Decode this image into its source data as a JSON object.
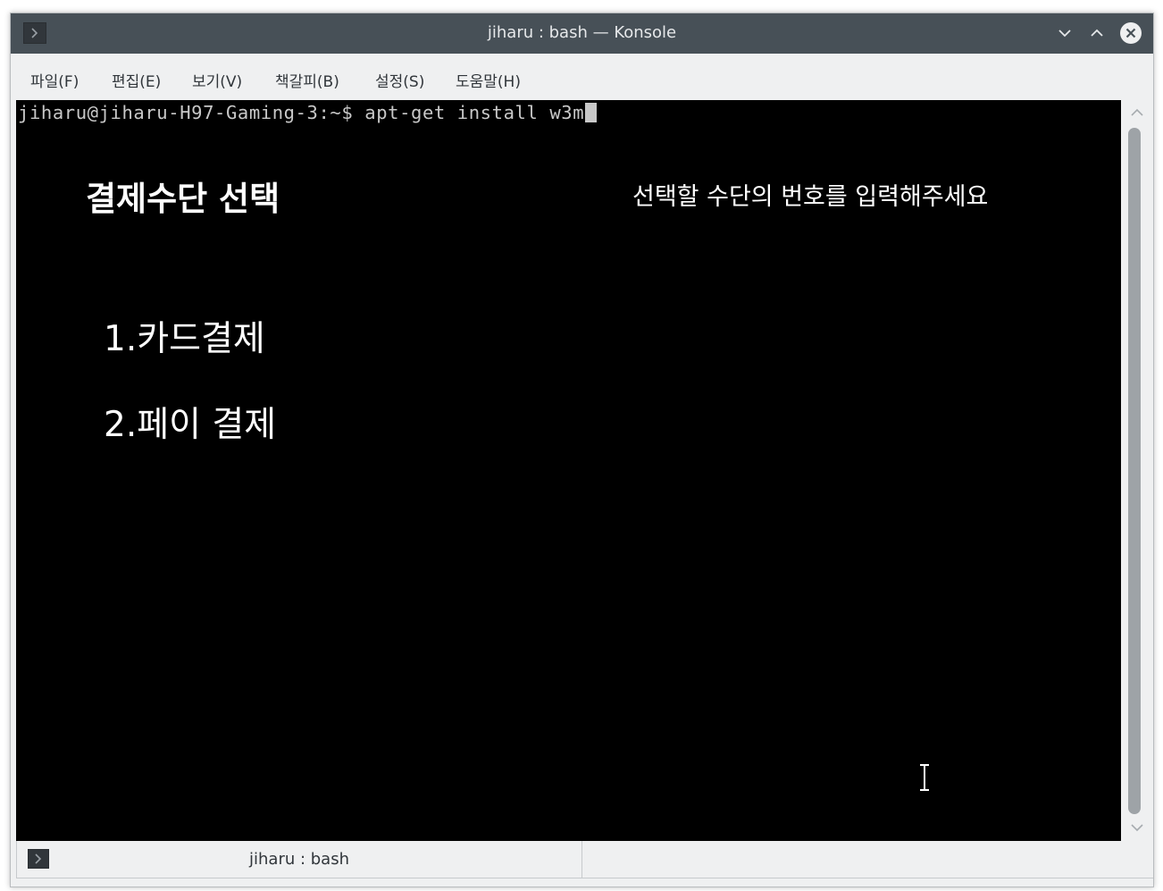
{
  "window": {
    "title": "jiharu : bash — Konsole",
    "icons": {
      "app": "terminal-icon",
      "minimize": "chevron-down-icon",
      "maximize": "chevron-up-icon",
      "close": "close-icon"
    }
  },
  "menubar": {
    "items": [
      "파일(F)",
      "편집(E)",
      "보기(V)",
      "책갈피(B)",
      "설정(S)",
      "도움말(H)"
    ]
  },
  "terminal": {
    "prompt": "jiharu@jiharu-H97-Gaming-3:~$ apt-get install w3m",
    "screen_title": "결제수단 선택",
    "screen_hint": "선택할 수단의 번호를 입력해주세요",
    "options": [
      "1.카드결제",
      "2.페이 결제"
    ],
    "colors": {
      "background": "#000000",
      "text": "#ffffff",
      "prompt_text": "#c8c8c8"
    }
  },
  "tabs": [
    {
      "label": "jiharu : bash",
      "icon": "terminal-icon"
    }
  ],
  "colors": {
    "titlebar": "#475057",
    "chrome": "#eff0f1",
    "scroll_thumb": "#9ea3a7"
  }
}
